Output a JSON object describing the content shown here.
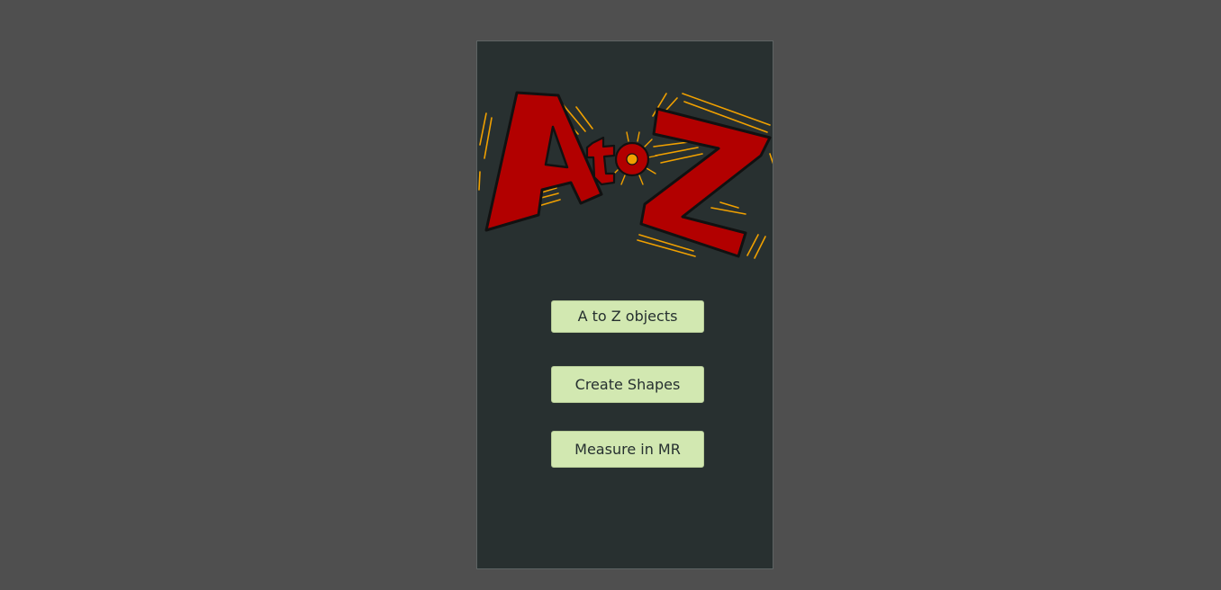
{
  "logo": {
    "text_big_a": "A",
    "text_small": "to",
    "text_big_z": "Z",
    "colors": {
      "letter_fill": "#b20000",
      "letter_outline": "#111111",
      "rays": "#f0a000"
    }
  },
  "menu": {
    "buttons": [
      {
        "label": "A to Z objects"
      },
      {
        "label": "Create Shapes"
      },
      {
        "label": "Measure in MR"
      }
    ]
  },
  "colors": {
    "background": "#4f4f4f",
    "panel": "#283030",
    "button_bg": "#d2e8b1",
    "button_text": "#263030"
  }
}
